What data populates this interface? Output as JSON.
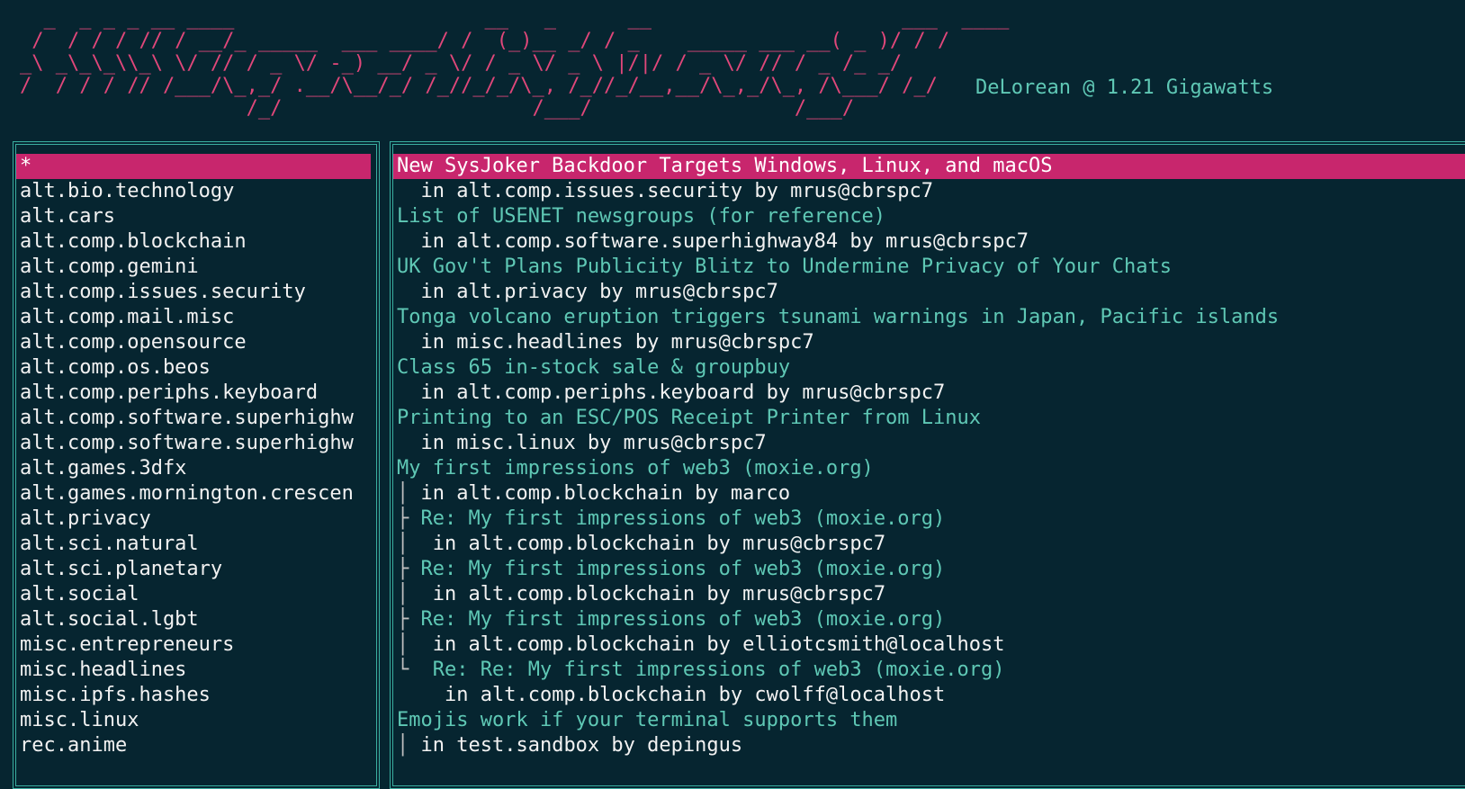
{
  "header": {
    "banner_ascii": "  _  _ _ _ __ ____                     __   _      __                     ___  ____\n /  / / / // / __/_ _____  ___ ____/ /  (_)__ _/ / _    _____ ___ __( _ )/ / /\n_\\ _\\_\\_\\\\_\\ \\/ // / _ \\/ -_) __/ _ \\/ / _ \\/ _ \\ |/|/ / _ \\/ // / _ /_ _/\n/  / / / // /___/\\_,_/ .__/\\__/_/ /_//_/_/\\_, /_//_/__,__/\\_,_/\\_, /\\___/ /_/\n                   /_/                     /___/                 /___/",
    "tagline": "DeLorean @ 1.21 Gigawatts"
  },
  "colors": {
    "background": "#062530",
    "accent_pink": "#e0477a",
    "selection": "#c8266d",
    "teal": "#5fc8b5",
    "border": "#3aaea0"
  },
  "groups": [
    "*",
    "alt.bio.technology",
    "alt.cars",
    "alt.comp.blockchain",
    "alt.comp.gemini",
    "alt.comp.issues.security",
    "alt.comp.mail.misc",
    "alt.comp.opensource",
    "alt.comp.os.beos",
    "alt.comp.periphs.keyboard",
    "alt.comp.software.superhighw",
    "alt.comp.software.superhighw",
    "alt.games.3dfx",
    "alt.games.mornington.crescen",
    "alt.privacy",
    "alt.sci.natural",
    "alt.sci.planetary",
    "alt.social",
    "alt.social.lgbt",
    "misc.entrepreneurs",
    "misc.headlines",
    "misc.ipfs.hashes",
    "misc.linux",
    "rec.anime"
  ],
  "articles": [
    {
      "prefix": "",
      "subject": "New SysJoker Backdoor Targets Windows, Linux, and macOS",
      "meta_prefix": "  ",
      "meta": "in alt.comp.issues.security by mrus@cbrspc7",
      "selected": true
    },
    {
      "prefix": "",
      "subject": "List of USENET newsgroups (for reference)",
      "meta_prefix": "  ",
      "meta": "in alt.comp.software.superhighway84 by mrus@cbrspc7"
    },
    {
      "prefix": "",
      "subject": "UK Gov't Plans Publicity Blitz to Undermine Privacy of Your Chats",
      "meta_prefix": "  ",
      "meta": "in alt.privacy by mrus@cbrspc7"
    },
    {
      "prefix": "",
      "subject": "Tonga volcano eruption triggers tsunami warnings in Japan, Pacific islands",
      "meta_prefix": "  ",
      "meta": "in misc.headlines by mrus@cbrspc7"
    },
    {
      "prefix": "",
      "subject": "Class 65 in-stock sale & groupbuy",
      "meta_prefix": "  ",
      "meta": "in alt.comp.periphs.keyboard by mrus@cbrspc7"
    },
    {
      "prefix": "",
      "subject": "Printing to an ESC/POS Receipt Printer from Linux",
      "meta_prefix": "  ",
      "meta": "in misc.linux by mrus@cbrspc7"
    },
    {
      "prefix": "",
      "subject": "My first impressions of web3 (moxie.org)",
      "meta_prefix": "│ ",
      "meta": "in alt.comp.blockchain by marco"
    },
    {
      "prefix": "├ ",
      "subject": "Re: My first impressions of web3 (moxie.org)",
      "meta_prefix": "│  ",
      "meta": "in alt.comp.blockchain by mrus@cbrspc7"
    },
    {
      "prefix": "├ ",
      "subject": "Re: My first impressions of web3 (moxie.org)",
      "meta_prefix": "│  ",
      "meta": "in alt.comp.blockchain by mrus@cbrspc7"
    },
    {
      "prefix": "├ ",
      "subject": "Re: My first impressions of web3 (moxie.org)",
      "meta_prefix": "│  ",
      "meta": "in alt.comp.blockchain by elliotcsmith@localhost"
    },
    {
      "prefix": "└  ",
      "subject": "Re: Re: My first impressions of web3 (moxie.org)",
      "meta_prefix": "    ",
      "meta": "in alt.comp.blockchain by cwolff@localhost"
    },
    {
      "prefix": "",
      "subject": "Emojis work if your terminal supports them",
      "meta_prefix": "│ ",
      "meta": "in test.sandbox by depingus"
    }
  ]
}
